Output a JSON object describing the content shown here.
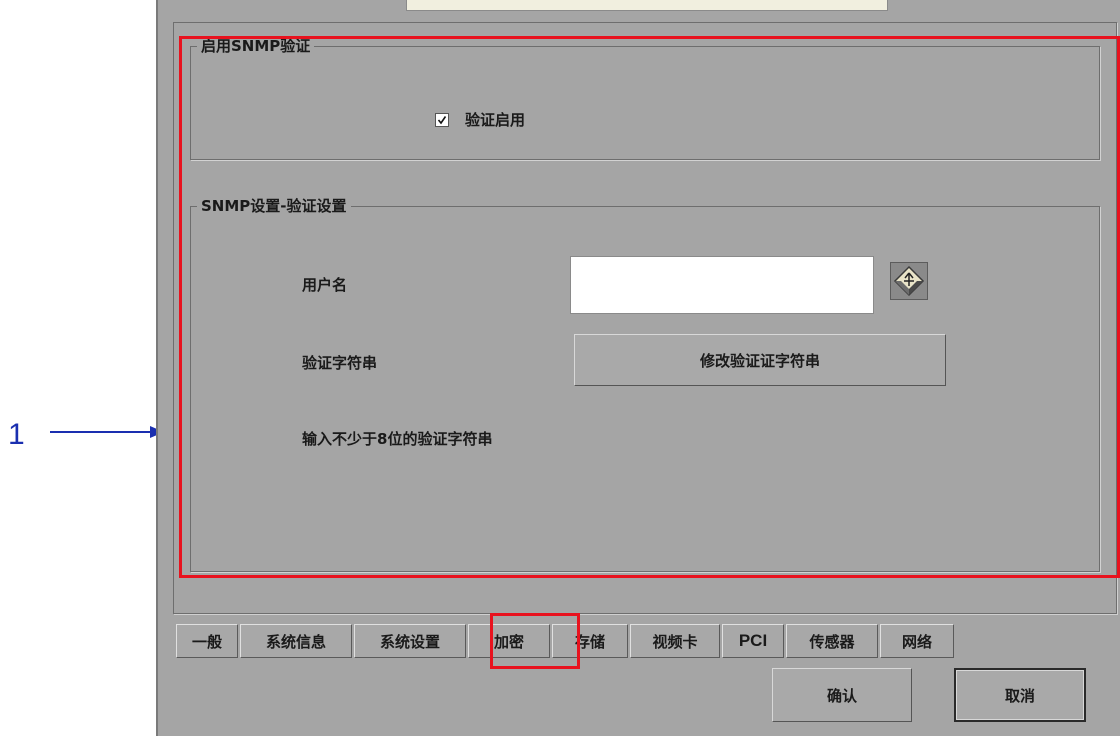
{
  "callout": {
    "number": "1"
  },
  "snmp_enable": {
    "title": "启用SNMP验证",
    "checkbox_label": "验证启用",
    "checked": true
  },
  "auth_settings": {
    "title": "SNMP设置-验证设置",
    "username_label": "用户名",
    "username_value": "",
    "auth_string_label": "验证字符串",
    "modify_button": "修改验证证字符串",
    "hint": "输入不少于8位的验证字符串"
  },
  "tabs": [
    {
      "label": "一般"
    },
    {
      "label": "系统信息"
    },
    {
      "label": "系统设置"
    },
    {
      "label": "加密",
      "highlighted": true
    },
    {
      "label": "存储"
    },
    {
      "label": "视频卡"
    },
    {
      "label": "PCI"
    },
    {
      "label": "传感器"
    },
    {
      "label": "网络"
    }
  ],
  "footer": {
    "confirm_button": "确认",
    "cancel_button": "取消"
  },
  "icons": {
    "keyboard_button": "on-screen-keyboard-icon",
    "checkmark": "checkmark-icon",
    "arrow": "right-arrow-icon"
  },
  "colors": {
    "highlight": "#e8121e",
    "callout": "#1a2fb0",
    "panel_bg": "#a5a5a5"
  }
}
